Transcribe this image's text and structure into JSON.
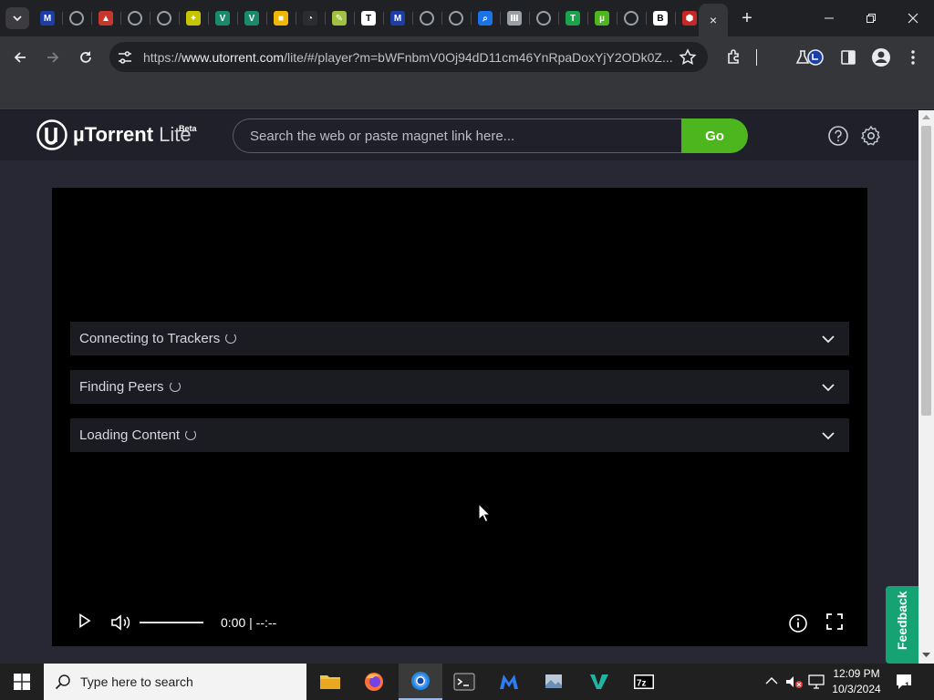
{
  "browser": {
    "address": {
      "prefix": "https://",
      "host": "www.utorrent.com",
      "path": "/lite/#/player?m=bWFnbmV0Oj94dD11cm46YnRpaDoxYjY2ODk0Z..."
    },
    "active_tab_close": "×",
    "new_tab": "+"
  },
  "tab_icons": [
    {
      "name": "malwarebytes-icon",
      "bg": "#1b3ea8",
      "glyph": "M"
    },
    {
      "name": "globe-icon",
      "bg": "#5f6368",
      "glyph": ""
    },
    {
      "name": "image-icon",
      "bg": "#c8372d",
      "glyph": "▲"
    },
    {
      "name": "globe-icon",
      "bg": "#e8eaed",
      "glyph": ""
    },
    {
      "name": "globe-icon",
      "bg": "#5f6368",
      "glyph": ""
    },
    {
      "name": "bird-icon",
      "bg": "#c6c600",
      "glyph": "✦"
    },
    {
      "name": "vs-icon",
      "bg": "#1a8a6d",
      "glyph": "V"
    },
    {
      "name": "vs-icon",
      "bg": "#1a8a6d",
      "glyph": "V"
    },
    {
      "name": "colorful-icon",
      "bg": "#f2b705",
      "glyph": "■"
    },
    {
      "name": "speedometer-icon",
      "bg": "#2b2c30",
      "glyph": "◔"
    },
    {
      "name": "pencil-icon",
      "bg": "#a0c040",
      "glyph": "✎"
    },
    {
      "name": "t-icon",
      "bg": "#ffffff",
      "glyph": "T"
    },
    {
      "name": "malwarebytes-icon",
      "bg": "#1b3ea8",
      "glyph": "M"
    },
    {
      "name": "globe-icon",
      "bg": "#5f6368",
      "glyph": ""
    },
    {
      "name": "globe-icon",
      "bg": "#5f6368",
      "glyph": ""
    },
    {
      "name": "search-icon",
      "bg": "#1a73e8",
      "glyph": "⌕"
    },
    {
      "name": "bank-icon",
      "bg": "#9aa0a6",
      "glyph": "Ⅲ"
    },
    {
      "name": "globe-icon",
      "bg": "#5f6368",
      "glyph": ""
    },
    {
      "name": "t-green-icon",
      "bg": "#1aa34a",
      "glyph": "T"
    },
    {
      "name": "utorrent-icon",
      "bg": "#4db51d",
      "glyph": "µ"
    },
    {
      "name": "globe-icon",
      "bg": "#5f6368",
      "glyph": ""
    },
    {
      "name": "b-icon",
      "bg": "#ffffff",
      "glyph": "B"
    },
    {
      "name": "shield-icon",
      "bg": "#c62828",
      "glyph": "⬢"
    }
  ],
  "app": {
    "logo_main": "µTorrent",
    "logo_lite": " Lite",
    "logo_beta": "Beta",
    "search_placeholder": "Search the web or paste magnet link here...",
    "go_label": "Go"
  },
  "panels": [
    {
      "label": "Connecting to Trackers"
    },
    {
      "label": "Finding Peers"
    },
    {
      "label": "Loading Content"
    }
  ],
  "player": {
    "time_current": "0:00",
    "time_sep": " | ",
    "time_total": "--:--",
    "volume": 1.0
  },
  "feedback_label": "Feedback",
  "taskbar": {
    "search_placeholder": "Type here to search",
    "time": "12:09 PM",
    "date": "10/3/2024",
    "notification_count": "1"
  }
}
